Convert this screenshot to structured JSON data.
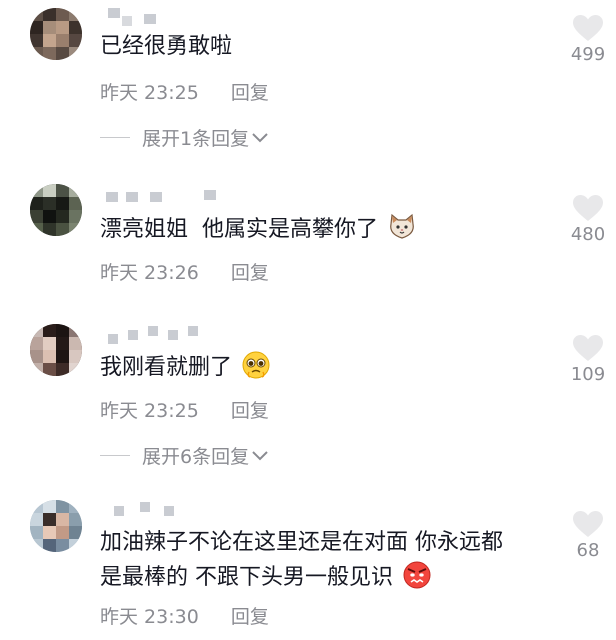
{
  "comments": [
    {
      "text": "已经很勇敢啦",
      "time": "昨天 23:25",
      "reply": "回复",
      "likes": "499"
    },
    {
      "text": "漂亮姐姐  他属实是高攀你了",
      "time": "昨天 23:26",
      "reply": "回复",
      "likes": "480",
      "emoji": "cat-face-emoji"
    },
    {
      "text": "我刚看就删了",
      "time": "昨天 23:25",
      "reply": "回复",
      "likes": "109",
      "emoji": "pleading-face-emoji"
    },
    {
      "text_line1": "加油辣子不论在这里还是在对面 你永远都",
      "text_line2": "是最棒的 不跟下头男一般见识",
      "time": "昨天 23:30",
      "reply": "回复",
      "likes": "68",
      "emoji": "angry-face-emoji"
    }
  ],
  "expand_replies": [
    {
      "label": "展开1条回复"
    },
    {
      "label": "展开6条回复"
    }
  ],
  "colors": {
    "text": "#161823",
    "meta": "#8a8b91",
    "heart": "#e8e8ea"
  },
  "icons": {
    "like": "heart-icon",
    "expand": "chevron-down-icon"
  }
}
